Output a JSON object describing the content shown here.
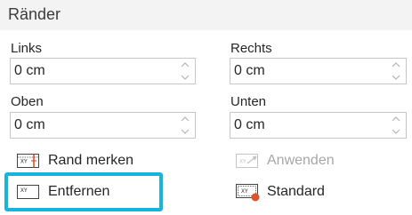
{
  "header": {
    "title": "Ränder"
  },
  "fields": {
    "links": {
      "label": "Links",
      "value": "0 cm"
    },
    "rechts": {
      "label": "Rechts",
      "value": "0 cm"
    },
    "oben": {
      "label": "Oben",
      "value": "0 cm"
    },
    "unten": {
      "label": "Unten",
      "value": "0 cm"
    }
  },
  "commands": {
    "rand_merken": "Rand merken",
    "anwenden": "Anwenden",
    "entfernen": "Entfernen",
    "standard": "Standard"
  },
  "icons": {
    "xy_label": "XY",
    "accent": "#e0522a",
    "focus": "#17b4dc"
  }
}
